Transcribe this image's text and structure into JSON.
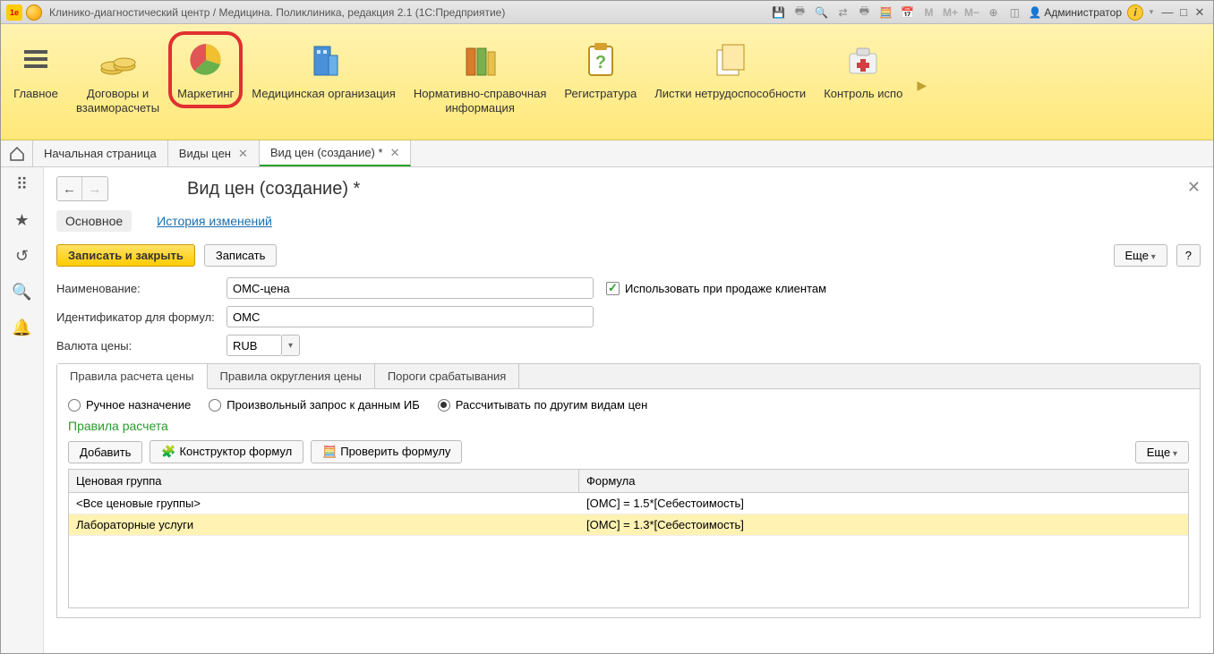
{
  "titlebar": {
    "title": "Клинико-диагностический центр / Медицина. Поликлиника, редакция 2.1  (1С:Предприятие)",
    "user": "Администратор",
    "logo_text": "1e"
  },
  "sections": {
    "items": [
      {
        "label": "Главное"
      },
      {
        "label": "Договоры и\nвзаиморасчеты"
      },
      {
        "label": "Маркетинг"
      },
      {
        "label": "Медицинская организация"
      },
      {
        "label": "Нормативно-справочная\nинформация"
      },
      {
        "label": "Регистратура"
      },
      {
        "label": "Листки нетрудоспособности"
      },
      {
        "label": "Контроль испо"
      }
    ]
  },
  "tabs": {
    "home": "Начальная страница",
    "items": [
      {
        "label": "Виды цен"
      },
      {
        "label": "Вид цен (создание) *",
        "active": true
      }
    ]
  },
  "page": {
    "title": "Вид цен (создание) *",
    "subtabs": {
      "main": "Основное",
      "history": "История изменений"
    },
    "cmd": {
      "save_close": "Записать и закрыть",
      "save": "Записать",
      "more": "Еще",
      "help": "?"
    },
    "fields": {
      "name_label": "Наименование:",
      "name_value": "ОМС-цена",
      "id_label": "Идентификатор для формул:",
      "id_value": "ОМС",
      "currency_label": "Валюта цены:",
      "currency_value": "RUB",
      "use_checkbox": "Использовать при продаже клиентам"
    },
    "inner_tabs": {
      "rules": "Правила расчета цены",
      "rounding": "Правила округления цены",
      "thresholds": "Пороги срабатывания"
    },
    "radios": {
      "manual": "Ручное назначение",
      "query": "Произвольный запрос к данным ИБ",
      "calc": "Рассчитывать по другим видам цен"
    },
    "rules": {
      "title": "Правила расчета",
      "add": "Добавить",
      "constructor": "Конструктор формул",
      "check": "Проверить формулу",
      "more": "Еще",
      "col_group": "Ценовая группа",
      "col_formula": "Формула",
      "rows": [
        {
          "group": "<Все ценовые группы>",
          "formula": "[ОМС] = 1.5*[Себестоимость]"
        },
        {
          "group": "Лабораторные услуги",
          "formula": "[ОМС] = 1.3*[Себестоимость]"
        }
      ]
    }
  }
}
